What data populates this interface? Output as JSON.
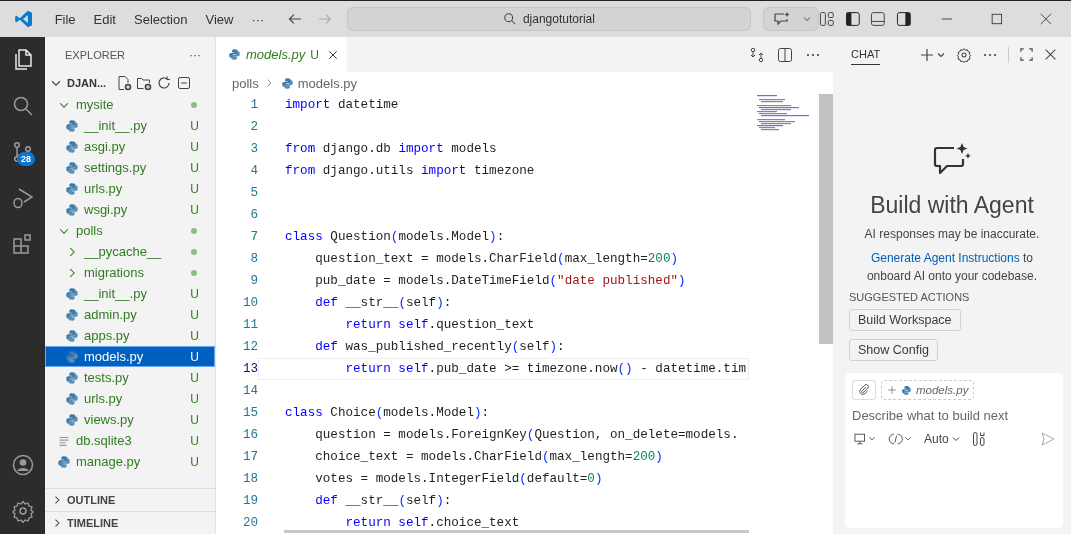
{
  "title_bar": {
    "menus": [
      "File",
      "Edit",
      "Selection",
      "View"
    ],
    "more": "···",
    "search": "djangotutorial"
  },
  "activity_bar": {
    "items": [
      {
        "kind": "files",
        "selected": true
      },
      {
        "kind": "search",
        "selected": false
      },
      {
        "kind": "source-control",
        "selected": false,
        "badge": "28"
      },
      {
        "kind": "run",
        "selected": false
      },
      {
        "kind": "extensions",
        "selected": false
      }
    ],
    "bottom": [
      {
        "kind": "account"
      },
      {
        "kind": "settings"
      }
    ]
  },
  "sidebar": {
    "title": "EXPLORER",
    "more": "···",
    "root": {
      "label": "DJAN...",
      "expanded": true,
      "children": [
        {
          "name": "mysite",
          "kind": "folder",
          "expanded": true,
          "modified": true,
          "selected": false,
          "children": [
            {
              "name": "__init__.py",
              "kind": "python",
              "status": "U",
              "selected": false
            },
            {
              "name": "asgi.py",
              "kind": "python",
              "status": "U",
              "selected": false
            },
            {
              "name": "settings.py",
              "kind": "python",
              "status": "U",
              "selected": false
            },
            {
              "name": "urls.py",
              "kind": "python",
              "status": "U",
              "selected": false
            },
            {
              "name": "wsgi.py",
              "kind": "python",
              "status": "U",
              "selected": false
            }
          ]
        },
        {
          "name": "polls",
          "kind": "folder",
          "expanded": true,
          "modified": true,
          "selected": false,
          "children": [
            {
              "name": "__pycache__",
              "kind": "folder",
              "expanded": false,
              "modified": true,
              "selected": false
            },
            {
              "name": "migrations",
              "kind": "folder",
              "expanded": false,
              "modified": true,
              "selected": false
            },
            {
              "name": "__init__.py",
              "kind": "python",
              "status": "U",
              "selected": false
            },
            {
              "name": "admin.py",
              "kind": "python",
              "status": "U",
              "selected": false
            },
            {
              "name": "apps.py",
              "kind": "python",
              "status": "U",
              "selected": false
            },
            {
              "name": "models.py",
              "kind": "python",
              "status": "U",
              "selected": true
            },
            {
              "name": "tests.py",
              "kind": "python",
              "status": "U",
              "selected": false
            },
            {
              "name": "urls.py",
              "kind": "python",
              "status": "U",
              "selected": false
            },
            {
              "name": "views.py",
              "kind": "python",
              "status": "U",
              "selected": false
            }
          ]
        },
        {
          "name": "db.sqlite3",
          "kind": "file",
          "status": "U",
          "selected": false
        },
        {
          "name": "manage.py",
          "kind": "python",
          "status": "U",
          "selected": false
        }
      ]
    },
    "sections": [
      {
        "label": "OUTLINE",
        "expanded": false
      },
      {
        "label": "TIMELINE",
        "expanded": false
      }
    ]
  },
  "editor": {
    "tab": {
      "label": "models.py",
      "status": "U",
      "selected": true
    },
    "breadcrumb": [
      "polls",
      "models.py"
    ],
    "lines": [
      {
        "number": "1",
        "current": false,
        "tokens": [
          {
            "kind": "kw",
            "text": "import"
          },
          {
            "kind": "plain",
            "text": " datetime"
          }
        ]
      },
      {
        "number": "2",
        "current": false
      },
      {
        "number": "3",
        "current": false,
        "tokens": [
          {
            "kind": "kw",
            "text": "from"
          },
          {
            "kind": "plain",
            "text": " django.db "
          },
          {
            "kind": "kw",
            "text": "import"
          },
          {
            "kind": "plain",
            "text": " models"
          }
        ]
      },
      {
        "number": "4",
        "current": false,
        "tokens": [
          {
            "kind": "kw",
            "text": "from"
          },
          {
            "kind": "plain",
            "text": " django.utils "
          },
          {
            "kind": "kw",
            "text": "import"
          },
          {
            "kind": "plain",
            "text": " timezone"
          }
        ]
      },
      {
        "number": "5",
        "current": false
      },
      {
        "number": "6",
        "current": false
      },
      {
        "number": "7",
        "current": false,
        "tokens": [
          {
            "kind": "kw",
            "text": "class"
          },
          {
            "kind": "plain",
            "text": " Question"
          },
          {
            "kind": "br",
            "text": "("
          },
          {
            "kind": "plain",
            "text": "models.Model"
          },
          {
            "kind": "br",
            "text": ")"
          },
          {
            "kind": "plain",
            "text": ":"
          }
        ]
      },
      {
        "number": "8",
        "current": false,
        "tokens": [
          {
            "kind": "plain",
            "text": "    question_text = models.CharField"
          },
          {
            "kind": "br",
            "text": "("
          },
          {
            "kind": "plain",
            "text": "max_length="
          },
          {
            "kind": "num",
            "text": "200"
          },
          {
            "kind": "br",
            "text": ")"
          }
        ]
      },
      {
        "number": "9",
        "current": false,
        "tokens": [
          {
            "kind": "plain",
            "text": "    pub_date = models.DateTimeField"
          },
          {
            "kind": "br",
            "text": "("
          },
          {
            "kind": "str",
            "text": "\"date published\""
          },
          {
            "kind": "br",
            "text": ")"
          }
        ]
      },
      {
        "number": "10",
        "current": false,
        "tokens": [
          {
            "kind": "kw",
            "text": "    def"
          },
          {
            "kind": "plain",
            "text": " __str__"
          },
          {
            "kind": "br",
            "text": "("
          },
          {
            "kind": "plain",
            "text": "self"
          },
          {
            "kind": "br",
            "text": ")"
          },
          {
            "kind": "plain",
            "text": ":"
          }
        ]
      },
      {
        "number": "11",
        "current": false,
        "tokens": [
          {
            "kind": "kw",
            "text": "        return self"
          },
          {
            "kind": "plain",
            "text": ".question_text"
          }
        ]
      },
      {
        "number": "12",
        "current": false,
        "tokens": [
          {
            "kind": "kw",
            "text": "    def"
          },
          {
            "kind": "plain",
            "text": " was_published_recently"
          },
          {
            "kind": "br",
            "text": "("
          },
          {
            "kind": "plain",
            "text": "self"
          },
          {
            "kind": "br",
            "text": ")"
          },
          {
            "kind": "plain",
            "text": ":"
          }
        ]
      },
      {
        "number": "13",
        "current": true,
        "tokens": [
          {
            "kind": "kw",
            "text": "        return self"
          },
          {
            "kind": "plain",
            "text": ".pub_date >= timezone.now"
          },
          {
            "kind": "br",
            "text": "()"
          },
          {
            "kind": "plain",
            "text": " - datetime.tim"
          }
        ]
      },
      {
        "number": "14",
        "current": false
      },
      {
        "number": "15",
        "current": false,
        "tokens": [
          {
            "kind": "kw",
            "text": "class"
          },
          {
            "kind": "plain",
            "text": " Choice"
          },
          {
            "kind": "br",
            "text": "("
          },
          {
            "kind": "plain",
            "text": "models.Model"
          },
          {
            "kind": "br",
            "text": ")"
          },
          {
            "kind": "plain",
            "text": ":"
          }
        ]
      },
      {
        "number": "16",
        "current": false,
        "tokens": [
          {
            "kind": "plain",
            "text": "    question = models.ForeignKey"
          },
          {
            "kind": "br",
            "text": "("
          },
          {
            "kind": "plain",
            "text": "Question, on_delete=models."
          }
        ]
      },
      {
        "number": "17",
        "current": false,
        "tokens": [
          {
            "kind": "plain",
            "text": "    choice_text = models.CharField"
          },
          {
            "kind": "br",
            "text": "("
          },
          {
            "kind": "plain",
            "text": "max_length="
          },
          {
            "kind": "num",
            "text": "200"
          },
          {
            "kind": "br",
            "text": ")"
          }
        ]
      },
      {
        "number": "18",
        "current": false,
        "tokens": [
          {
            "kind": "plain",
            "text": "    votes = models.IntegerField"
          },
          {
            "kind": "br",
            "text": "("
          },
          {
            "kind": "plain",
            "text": "default="
          },
          {
            "kind": "num",
            "text": "0"
          },
          {
            "kind": "br",
            "text": ")"
          }
        ]
      },
      {
        "number": "19",
        "current": false,
        "tokens": [
          {
            "kind": "kw",
            "text": "    def"
          },
          {
            "kind": "plain",
            "text": " __str__"
          },
          {
            "kind": "br",
            "text": "("
          },
          {
            "kind": "plain",
            "text": "self"
          },
          {
            "kind": "br",
            "text": ")"
          },
          {
            "kind": "plain",
            "text": ":"
          }
        ]
      },
      {
        "number": "20",
        "current": false,
        "tokens": [
          {
            "kind": "kw",
            "text": "        return self"
          },
          {
            "kind": "plain",
            "text": ".choice_text"
          }
        ]
      }
    ]
  },
  "chat": {
    "tab": "CHAT",
    "heading": "Build with Agent",
    "notice": "AI responses may be inaccurate.",
    "link": "Generate Agent Instructions",
    "link_suffix": " to onboard AI onto your codebase.",
    "suggested_title": "SUGGESTED ACTIONS",
    "actions": [
      "Build Workspace",
      "Show Config"
    ],
    "input": {
      "context_file": "models.py",
      "placeholder": "Describe what to build next",
      "mode": "Auto"
    }
  }
}
